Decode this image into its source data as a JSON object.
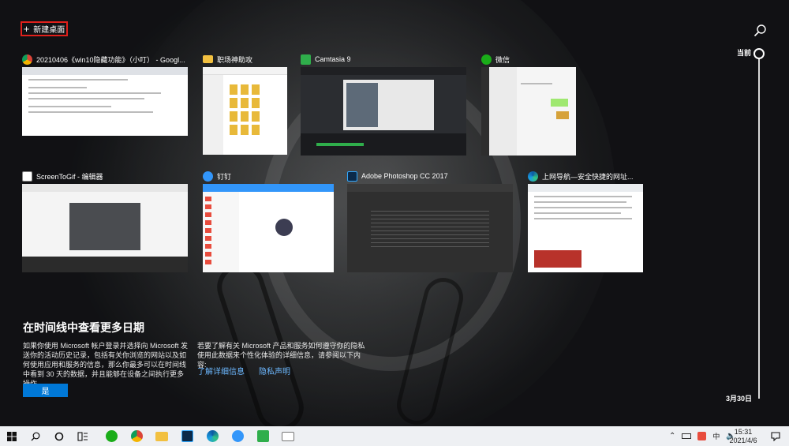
{
  "top": {
    "new_desktop_label": "新建桌面"
  },
  "timeline": {
    "current_label": "当前",
    "date_label": "3月30日"
  },
  "windows": [
    {
      "title": "20210406《win10隐藏功能》（小叮） - Googl...",
      "icon": "chrome-icon"
    },
    {
      "title": "职场神助攻",
      "icon": "folder-icon"
    },
    {
      "title": "Camtasia 9",
      "icon": "camtasia-icon"
    },
    {
      "title": "微信",
      "icon": "wechat-icon"
    },
    {
      "title": "ScreenToGif - 编辑器",
      "icon": "screentogif-icon"
    },
    {
      "title": "钉钉",
      "icon": "dingtalk-icon"
    },
    {
      "title": "Adobe Photoshop CC 2017",
      "icon": "photoshop-icon"
    },
    {
      "title": "上网导航—安全快捷的网址...",
      "icon": "edge-icon"
    }
  ],
  "info": {
    "title": "在时间线中查看更多日期",
    "left_text": "如果你使用 Microsoft 帐户登录并选择向 Microsoft 发送你的活动历史记录，包括有关你浏览的网站以及如何使用应用和服务的信息，那么你最多可以在时间线中看到 30 天的数据，并且能够在设备之间执行更多操作。",
    "right_text": "若要了解有关 Microsoft 产品和服务如何遵守你的隐私使用此数据来个性化体验的详细信息，请参阅以下内容:",
    "link_learn_more": "了解详细信息",
    "link_privacy": "隐私声明",
    "yes_button": "是"
  },
  "taskbar": {
    "tray_lang": "中",
    "clock_time": "15:31",
    "clock_date": "2021/4/6"
  },
  "colors": {
    "accent_blue": "#0078d7",
    "link_blue": "#6cb8ff",
    "highlight_red": "#e0201b"
  }
}
